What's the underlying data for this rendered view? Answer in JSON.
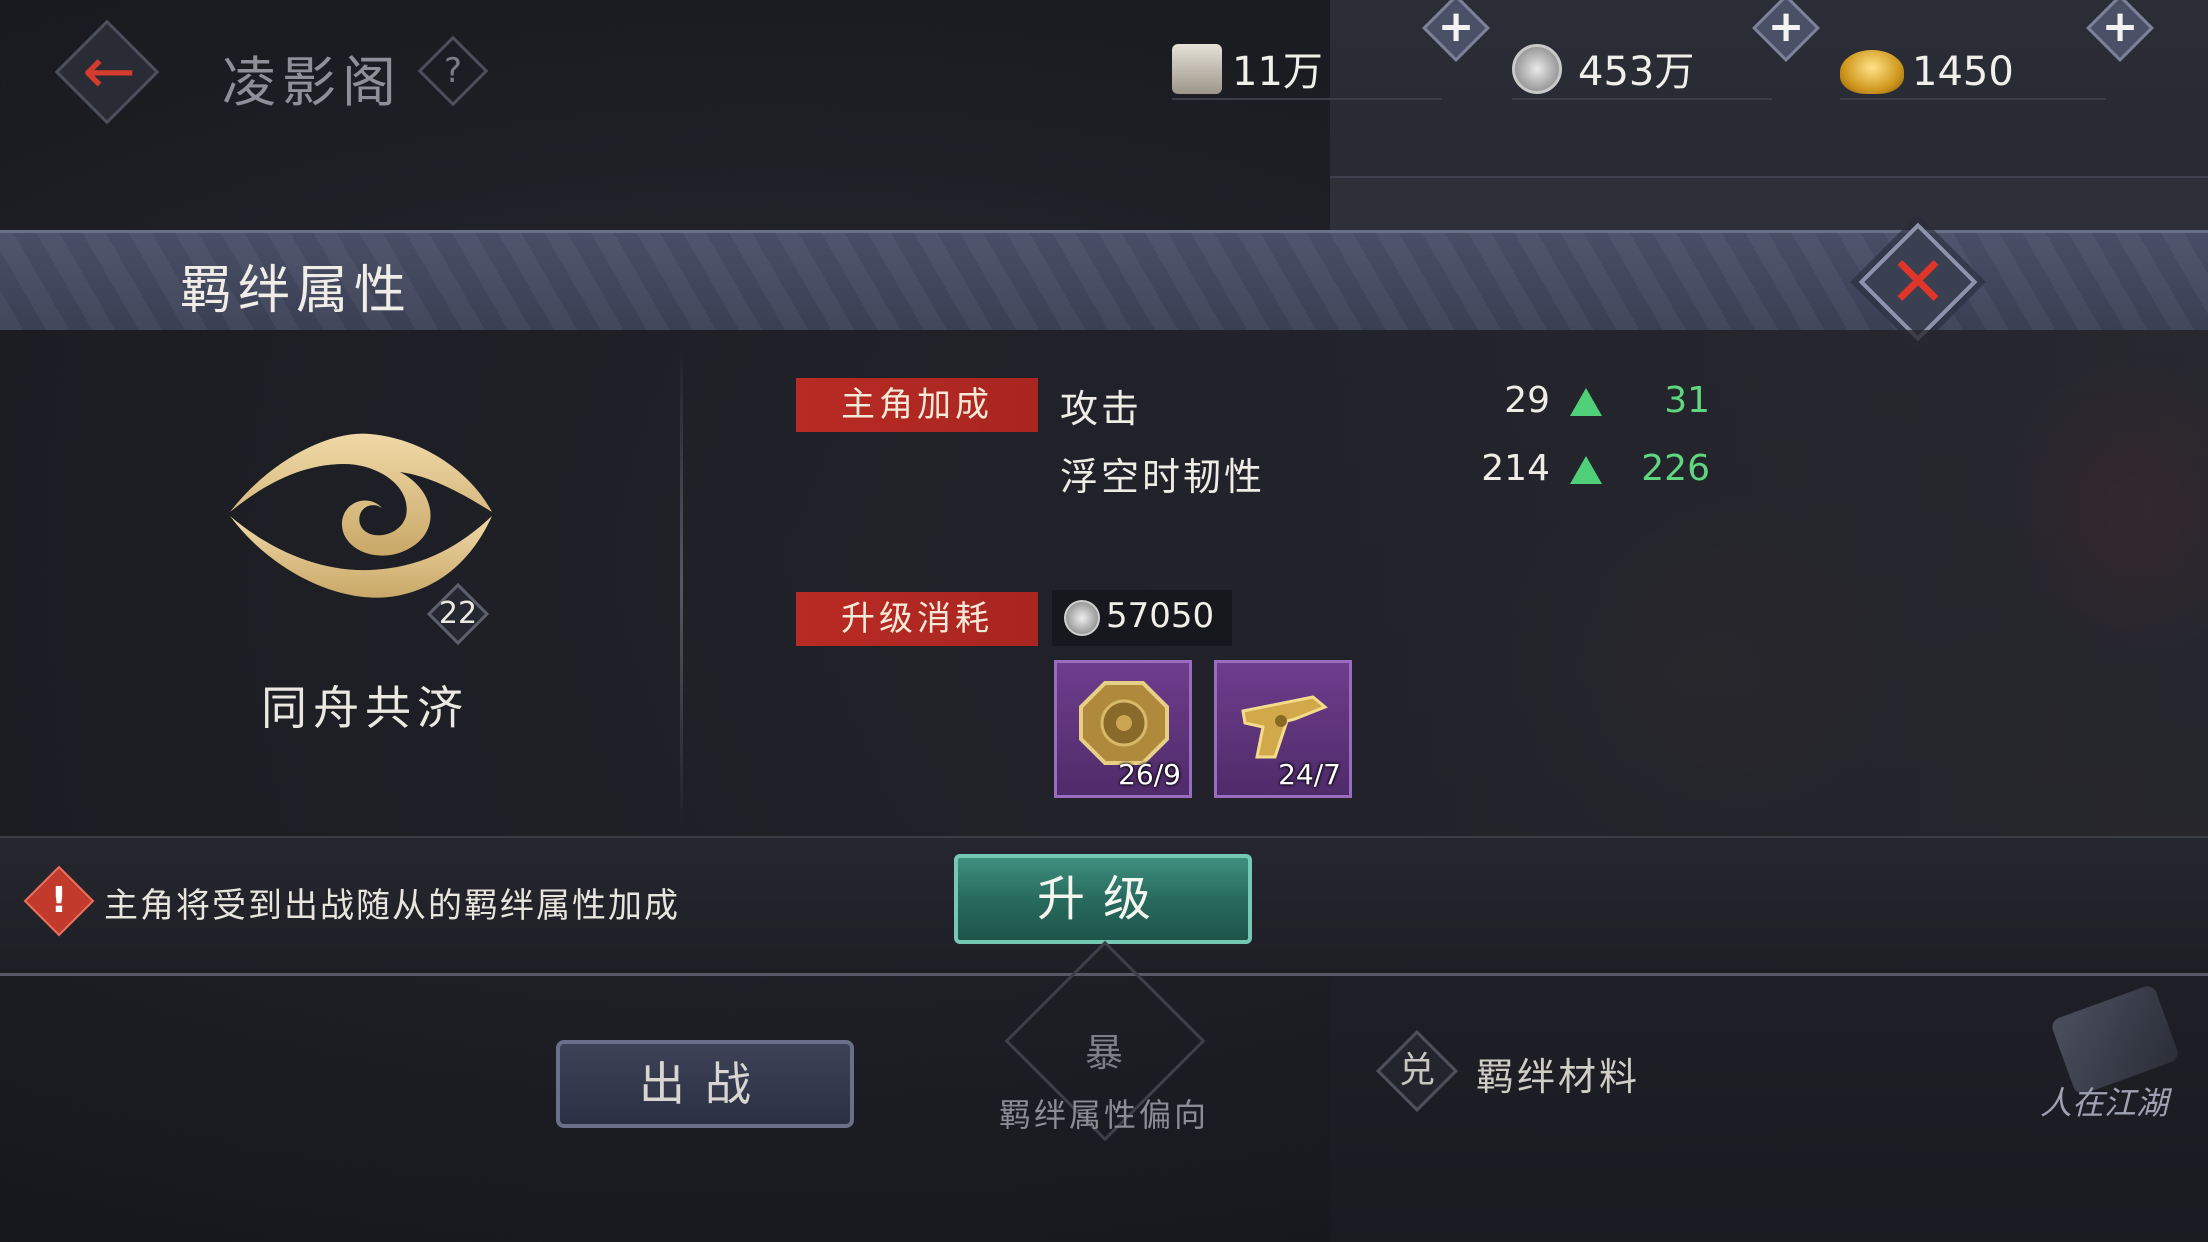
{
  "page": {
    "title": "凌影阁",
    "help_glyph": "?"
  },
  "resources": [
    {
      "icon": "scroll-icon",
      "value": "11万"
    },
    {
      "icon": "silver-coin-icon",
      "value": "453万"
    },
    {
      "icon": "gold-ingot-icon",
      "value": "1450"
    }
  ],
  "resource_plus_glyph": "+",
  "dialog": {
    "title": "羁绊属性",
    "close_glyph": "✕",
    "bond": {
      "name": "同舟共济",
      "level": "22"
    },
    "bonus_tag": "主角加成",
    "stats": [
      {
        "name": "攻击",
        "current": "29",
        "next": "31"
      },
      {
        "name": "浮空时韧性",
        "current": "214",
        "next": "226"
      }
    ],
    "cost_tag": "升级消耗",
    "cost_value": "57050",
    "materials": [
      {
        "icon": "bronze-medallion-icon",
        "count": "26/9"
      },
      {
        "icon": "golden-pistol-icon",
        "count": "24/7"
      }
    ],
    "warning_glyph": "!",
    "hint": "主角将受到出战随从的羁绊属性加成",
    "upgrade_label": "升级"
  },
  "bottom": {
    "deploy_label": "出战",
    "bias_glyph": "暴",
    "bias_label": "羁绊属性偏向",
    "exchange_glyph": "兑",
    "materials_label": "羁绊材料",
    "corner_label": "人在江湖"
  },
  "colors": {
    "accent_red": "#b82b24",
    "stat_up_green": "#5fd67f",
    "upgrade_teal": "#276b5e",
    "item_purple": "#6e3d8c"
  }
}
